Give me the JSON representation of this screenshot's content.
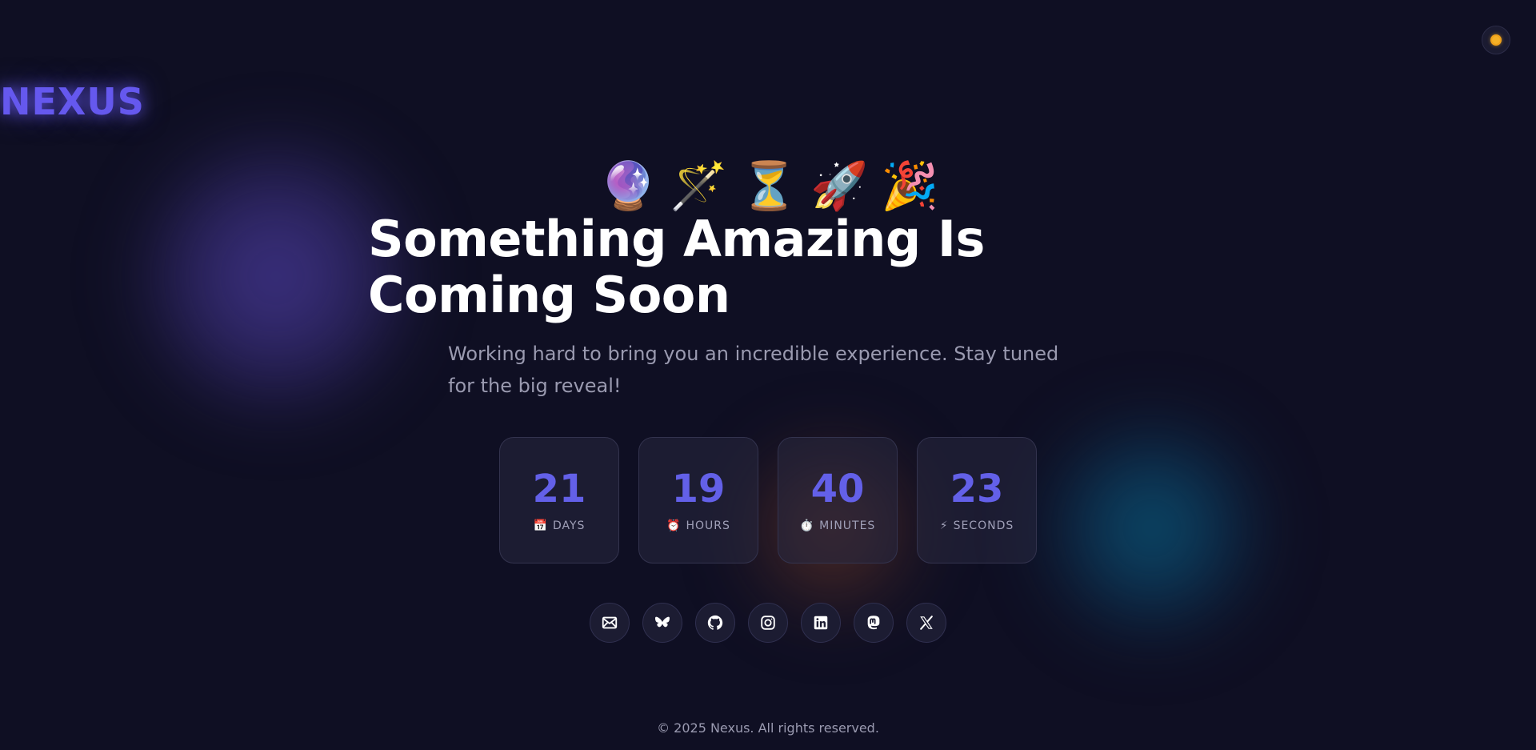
{
  "theme_toggle": {
    "icon": "sun-icon"
  },
  "brand": {
    "name": "NEXUS",
    "color": "#6558ee"
  },
  "hero": {
    "emojis": [
      "🔮",
      "🪄",
      "⏳",
      "🚀",
      "🎉"
    ],
    "headline_line1": "Something Amazing Is",
    "headline_line2": "Coming Soon",
    "subtitle": "Working hard to bring you an incredible experience. Stay tuned for the big reveal!"
  },
  "countdown": [
    {
      "value": "21",
      "icon": "📅",
      "label": "DAYS"
    },
    {
      "value": "19",
      "icon": "⏰",
      "label": "HOURS"
    },
    {
      "value": "40",
      "icon": "⏱️",
      "label": "MINUTES"
    },
    {
      "value": "23",
      "icon": "⚡",
      "label": "SECONDS"
    }
  ],
  "social": [
    {
      "name": "email",
      "icon": "mail-icon"
    },
    {
      "name": "bluesky",
      "icon": "butterfly-icon"
    },
    {
      "name": "github",
      "icon": "github-icon"
    },
    {
      "name": "instagram",
      "icon": "instagram-icon"
    },
    {
      "name": "linkedin",
      "icon": "linkedin-icon"
    },
    {
      "name": "mastodon",
      "icon": "mastodon-icon"
    },
    {
      "name": "x",
      "icon": "x-icon"
    }
  ],
  "footer": {
    "text": "© 2025 Nexus. All rights reserved."
  },
  "colors": {
    "background": "#0f0f23",
    "accent": "#6360e8",
    "muted_text": "#9a9ab0"
  }
}
